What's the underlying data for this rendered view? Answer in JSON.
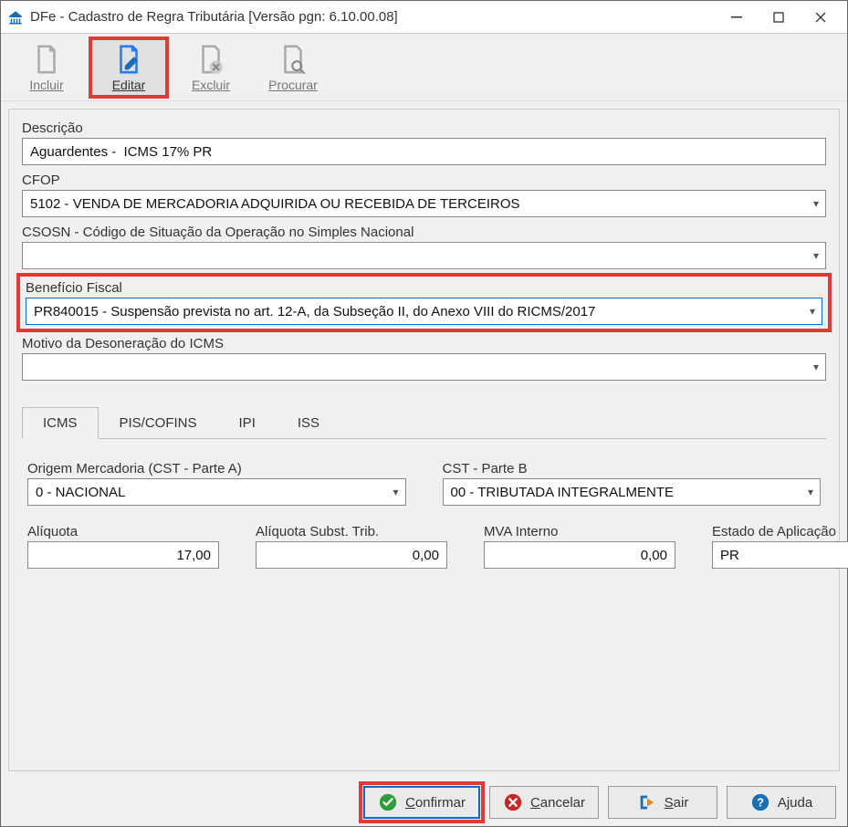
{
  "window": {
    "title": "DFe - Cadastro de Regra Tributária [Versão pgn: 6.10.00.08]"
  },
  "toolbar": {
    "incluir": "Incluir",
    "editar": "Editar",
    "excluir": "Excluir",
    "procurar": "Procurar"
  },
  "form": {
    "descricao_label": "Descrição",
    "descricao_value": "Aguardentes -  ICMS 17% PR",
    "cfop_label": "CFOP",
    "cfop_value": "5102 - VENDA DE MERCADORIA ADQUIRIDA OU RECEBIDA DE TERCEIROS",
    "csosn_label": "CSOSN - Código de Situação da Operação no Simples Nacional",
    "csosn_value": "",
    "beneficio_label": "Benefício Fiscal",
    "beneficio_value": "PR840015 - Suspensão prevista no art. 12-A, da Subseção II, do Anexo VIII do RICMS/2017",
    "motivo_label": "Motivo da Desoneração do ICMS",
    "motivo_value": ""
  },
  "tabs": {
    "icms": "ICMS",
    "piscofins": "PIS/COFINS",
    "ipi": "IPI",
    "iss": "ISS"
  },
  "icms": {
    "origem_label": "Origem Mercadoria (CST - Parte A)",
    "origem_value": "0 - NACIONAL",
    "cstb_label": "CST - Parte B",
    "cstb_value": "00 - TRIBUTADA INTEGRALMENTE",
    "aliquota_label": "Alíquota",
    "aliquota_value": "17,00",
    "aliquota_st_label": "Alíquota Subst. Trib.",
    "aliquota_st_value": "0,00",
    "mva_label": "MVA Interno",
    "mva_value": "0,00",
    "estado_label": "Estado de Aplicação",
    "estado_value": "PR"
  },
  "footer": {
    "confirmar": "Confirmar",
    "cancelar": "Cancelar",
    "sair": "Sair",
    "ajuda": "Ajuda"
  }
}
